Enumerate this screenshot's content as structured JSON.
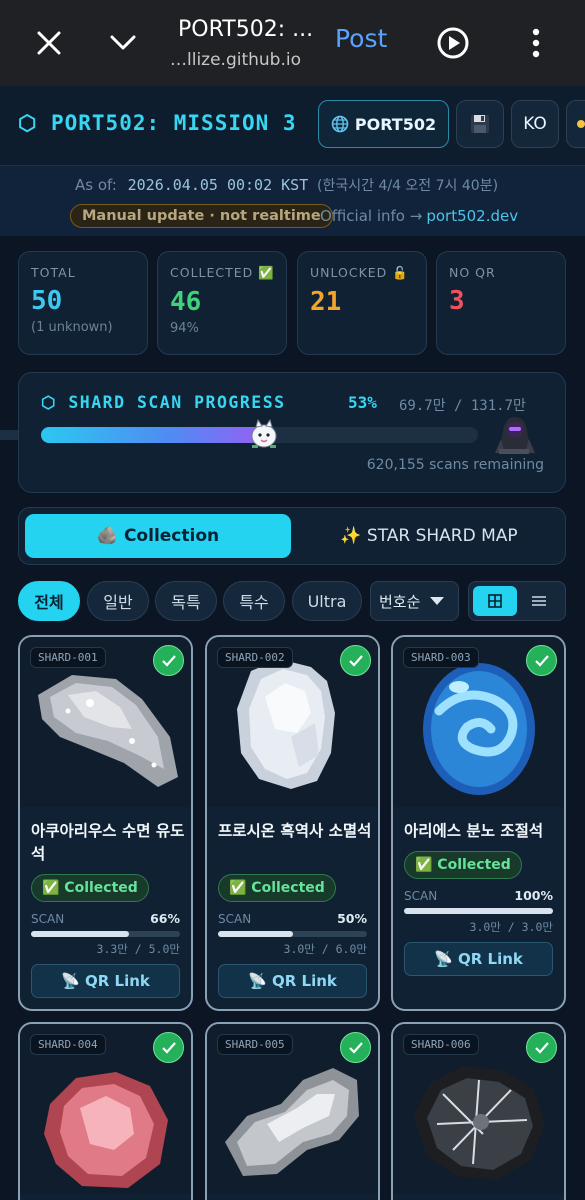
{
  "browser": {
    "title": "PORT502: ...",
    "url": "…llize.github.io",
    "post_label": "Post",
    "icons": [
      "close-icon",
      "chevron-down-icon",
      "play-icon",
      "more-vert-icon"
    ]
  },
  "header": {
    "brand": "⬡ PORT502: MISSION 3",
    "site_button": "PORT502",
    "save_icon": "save-icon",
    "lang_button": "KO"
  },
  "asof": {
    "label": "As of:",
    "datetime": "2026.04.05 00:02 KST",
    "local": "(한국시간 4/4 오전 7시 40분)",
    "badge": "Manual update · not realtime",
    "official_label": "Official info →",
    "official_link": "port502.dev"
  },
  "stats": [
    {
      "label": "TOTAL",
      "value": "50",
      "sub": "(1 unknown)",
      "color": "#3ec8f0"
    },
    {
      "label": "COLLECTED ✅",
      "value": "46",
      "sub": "94%",
      "color": "#3fd27a"
    },
    {
      "label": "UNLOCKED 🔓",
      "value": "21",
      "sub": "",
      "color": "#f4a42a"
    },
    {
      "label": "NO QR",
      "value": "3",
      "sub": "",
      "color": "#f0515a"
    }
  ],
  "progress": {
    "title": "⬡ SHARD SCAN PROGRESS",
    "percent_label": "53%",
    "percent": 53,
    "count": "69.7만 / 131.7만",
    "remaining": "620,155 scans remaining"
  },
  "tabs": {
    "collection": "🪨 Collection",
    "map": "✨ STAR SHARD MAP"
  },
  "filters": {
    "chips": [
      "전체",
      "일반",
      "독특",
      "특수",
      "Ultra"
    ],
    "sort": "번호순"
  },
  "cards": [
    {
      "id": "SHARD-001",
      "name": "아쿠아리우스 수면 유도석",
      "status": "✅ Collected",
      "scan_label": "SCAN",
      "scan_pct": "66%",
      "scan_value": 66,
      "scan_count": "3.3만 / 5.0만",
      "qr": "📡 QR Link"
    },
    {
      "id": "SHARD-002",
      "name": "프로시온 흑역사 소멸석",
      "status": "✅ Collected",
      "scan_label": "SCAN",
      "scan_pct": "50%",
      "scan_value": 50,
      "scan_count": "3.0만 / 6.0만",
      "qr": "📡 QR Link"
    },
    {
      "id": "SHARD-003",
      "name": "아리에스 분노 조절석",
      "status": "✅ Collected",
      "scan_label": "SCAN",
      "scan_pct": "100%",
      "scan_value": 100,
      "scan_count": "3.0만 / 3.0만",
      "qr": "📡 QR Link"
    },
    {
      "id": "SHARD-004"
    },
    {
      "id": "SHARD-005"
    },
    {
      "id": "SHARD-006"
    }
  ],
  "colors": {
    "accent": "#23d3ef",
    "background": "#0b1524",
    "collected": "#25b15a"
  }
}
